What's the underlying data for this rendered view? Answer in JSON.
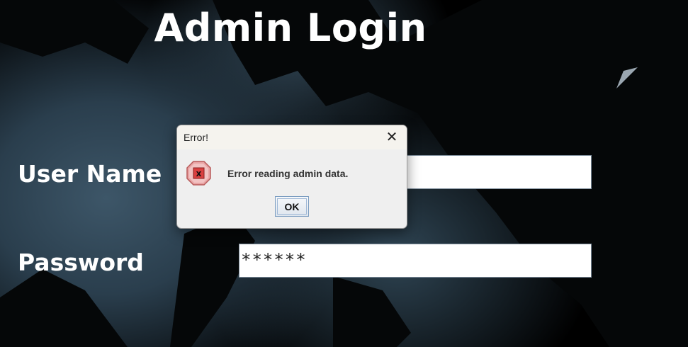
{
  "page": {
    "title": "Admin Login",
    "username_label": "User Name",
    "password_label": "Password",
    "username_value": "",
    "password_value": "******"
  },
  "dialog": {
    "title": "Error!",
    "close_icon": "close-icon",
    "error_icon": "error-icon",
    "message": "Error reading admin data.",
    "ok_label": "OK"
  },
  "colors": {
    "background": "#000000",
    "title_text": "#ffffff",
    "dialog_bg": "#efefef",
    "error_icon": "#d94040"
  }
}
